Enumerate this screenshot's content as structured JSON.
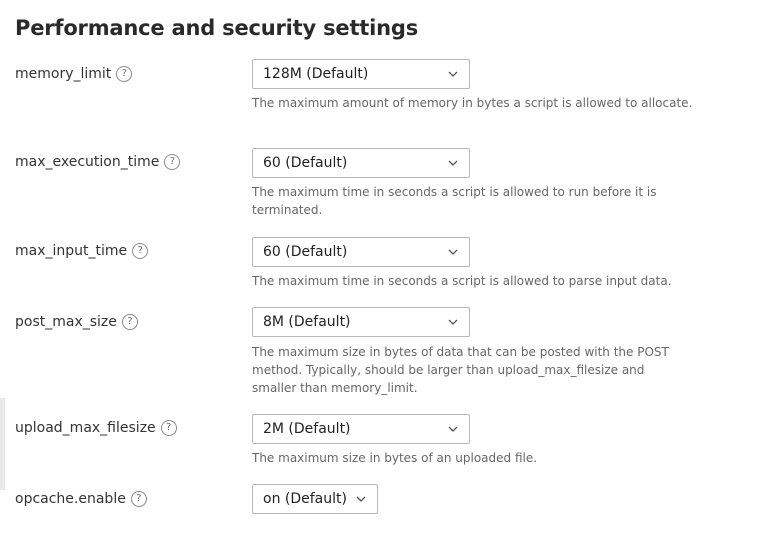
{
  "page": {
    "title": "Performance and security settings"
  },
  "help_symbol": "?",
  "settings": [
    {
      "label": "memory_limit",
      "value": "128M (Default)",
      "description": "The maximum amount of memory in bytes a script is allowed to allocate."
    },
    {
      "label": "max_execution_time",
      "value": "60 (Default)",
      "description": "The maximum time in seconds a script is allowed to run before it is terminated."
    },
    {
      "label": "max_input_time",
      "value": "60 (Default)",
      "description": "The maximum time in seconds a script is allowed to parse input data."
    },
    {
      "label": "post_max_size",
      "value": "8M (Default)",
      "description": "The maximum size in bytes of data that can be posted with the POST method. Typically, should be larger than upload_max_filesize and smaller than memory_limit."
    },
    {
      "label": "upload_max_filesize",
      "value": "2M (Default)",
      "description": "The maximum size in bytes of an uploaded file."
    },
    {
      "label": "opcache.enable",
      "value": "on (Default)",
      "description": ""
    }
  ],
  "icons": {
    "help": "question-circle-icon",
    "dropdown": "chevron-down-icon"
  },
  "colors": {
    "text": "#333333",
    "description": "#666666",
    "border": "#b8b8b8"
  }
}
